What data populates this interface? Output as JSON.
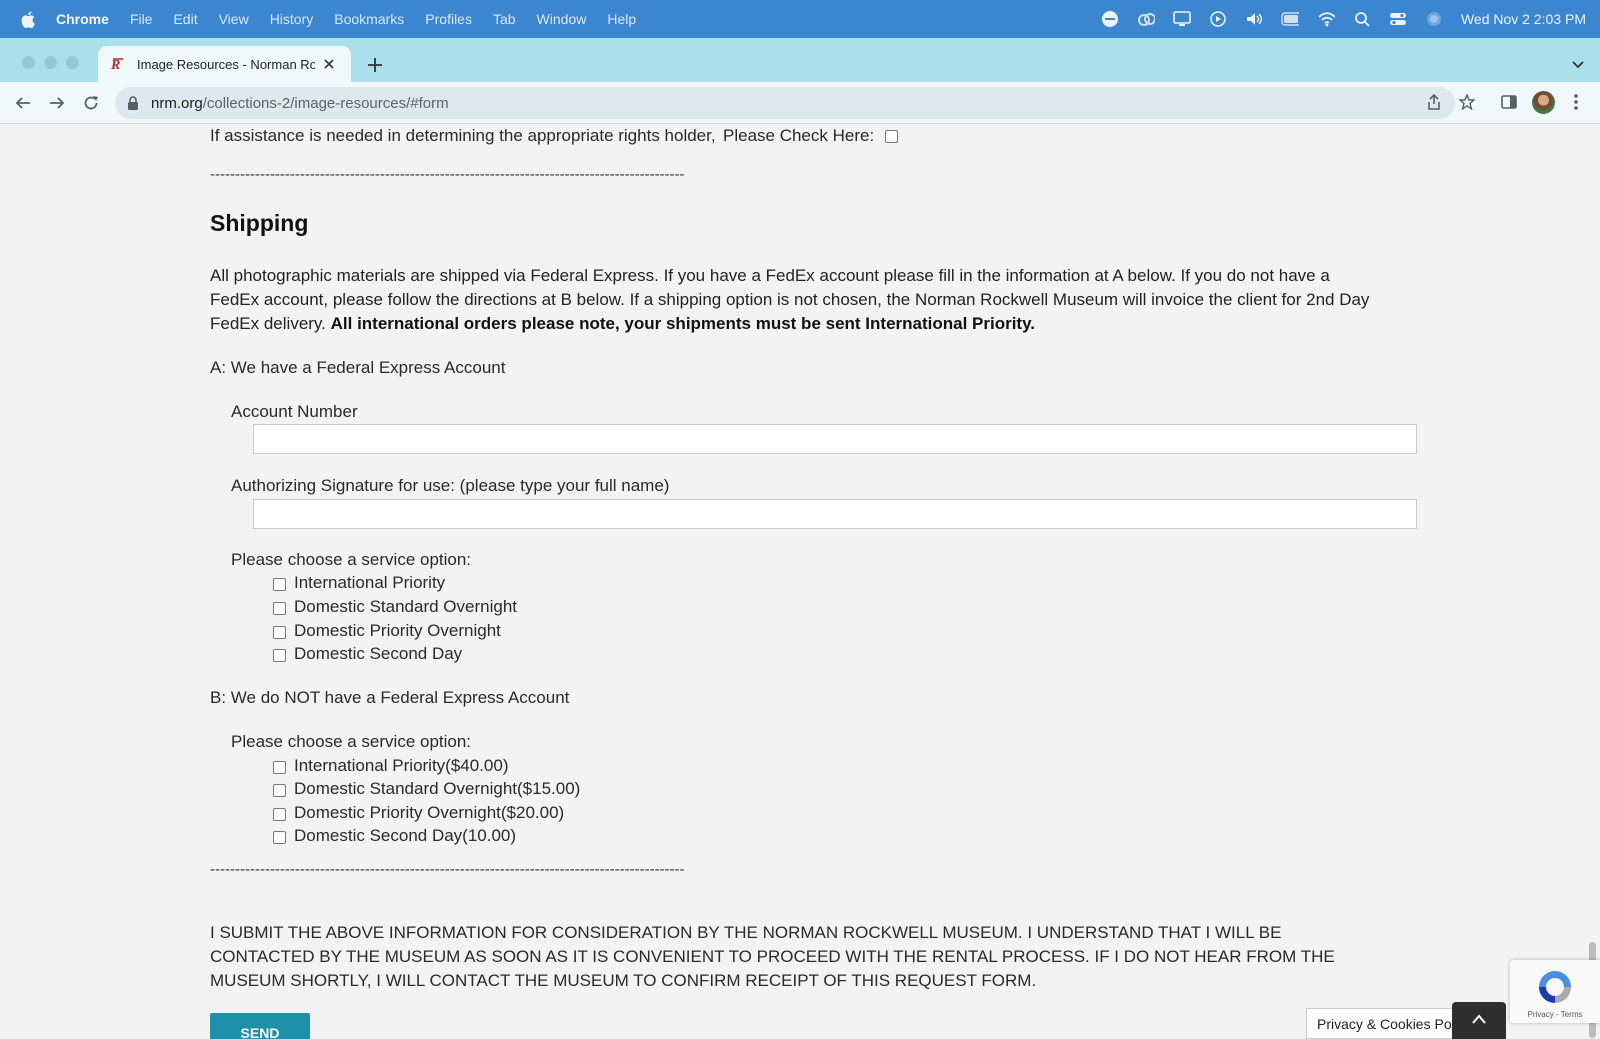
{
  "menubar": {
    "app": "Chrome",
    "items": [
      "File",
      "Edit",
      "View",
      "History",
      "Bookmarks",
      "Profiles",
      "Tab",
      "Window",
      "Help"
    ],
    "clock": "Wed Nov 2  2:03 PM"
  },
  "browser": {
    "tab_title": "Image Resources - Norman Rockwell Museum",
    "url_host": "nrm.org",
    "url_path": "/collections-2/image-resources/#form"
  },
  "form": {
    "assist_text": "If assistance is needed in determining the appropriate rights holder,",
    "assist_check_label": "Please Check Here:",
    "divider": "-----------------------------------------------------------------------------------------------",
    "shipping_heading": "Shipping",
    "shipping_para_plain": "All photographic materials are shipped via Federal Express. If you have a FedEx account please fill in the information at A below. If you do not have a FedEx account, please follow the directions at B below. If a shipping option is not chosen, the Norman Rockwell Museum will invoice the client for 2nd Day FedEx delivery. ",
    "shipping_para_bold": "All international orders please note, your shipments must be sent International Priority.",
    "section_a": "A: We have a Federal Express Account",
    "account_number_label": "Account Number",
    "account_number_value": "",
    "signature_label": "Authorizing Signature for use: (please type your full name)",
    "signature_value": "",
    "service_prompt": "Please choose a service option:",
    "options_a": [
      "International Priority",
      "Domestic Standard Overnight",
      "Domestic Priority Overnight",
      "Domestic Second Day"
    ],
    "section_b": "B: We do NOT have a Federal Express Account",
    "options_b": [
      "International Priority($40.00)",
      "Domestic Standard Overnight($15.00)",
      "Domestic Priority Overnight($20.00)",
      "Domestic Second Day(10.00)"
    ],
    "notice": "I SUBMIT THE ABOVE INFORMATION FOR CONSIDERATION BY THE NORMAN ROCKWELL MUSEUM. I UNDERSTAND THAT I WILL BE CONTACTED BY THE MUSEUM AS SOON AS IT IS CONVENIENT TO PROCEED WITH THE RENTAL PROCESS. IF I DO NOT HEAR FROM THE MUSEUM SHORTLY, I WILL CONTACT THE MUSEUM TO CONFIRM RECEIPT OF THIS REQUEST FORM.",
    "send_label": "SEND"
  },
  "recaptcha": {
    "terms": "Privacy - Terms"
  },
  "privacy_banner": "Privacy & Cookies Policy"
}
